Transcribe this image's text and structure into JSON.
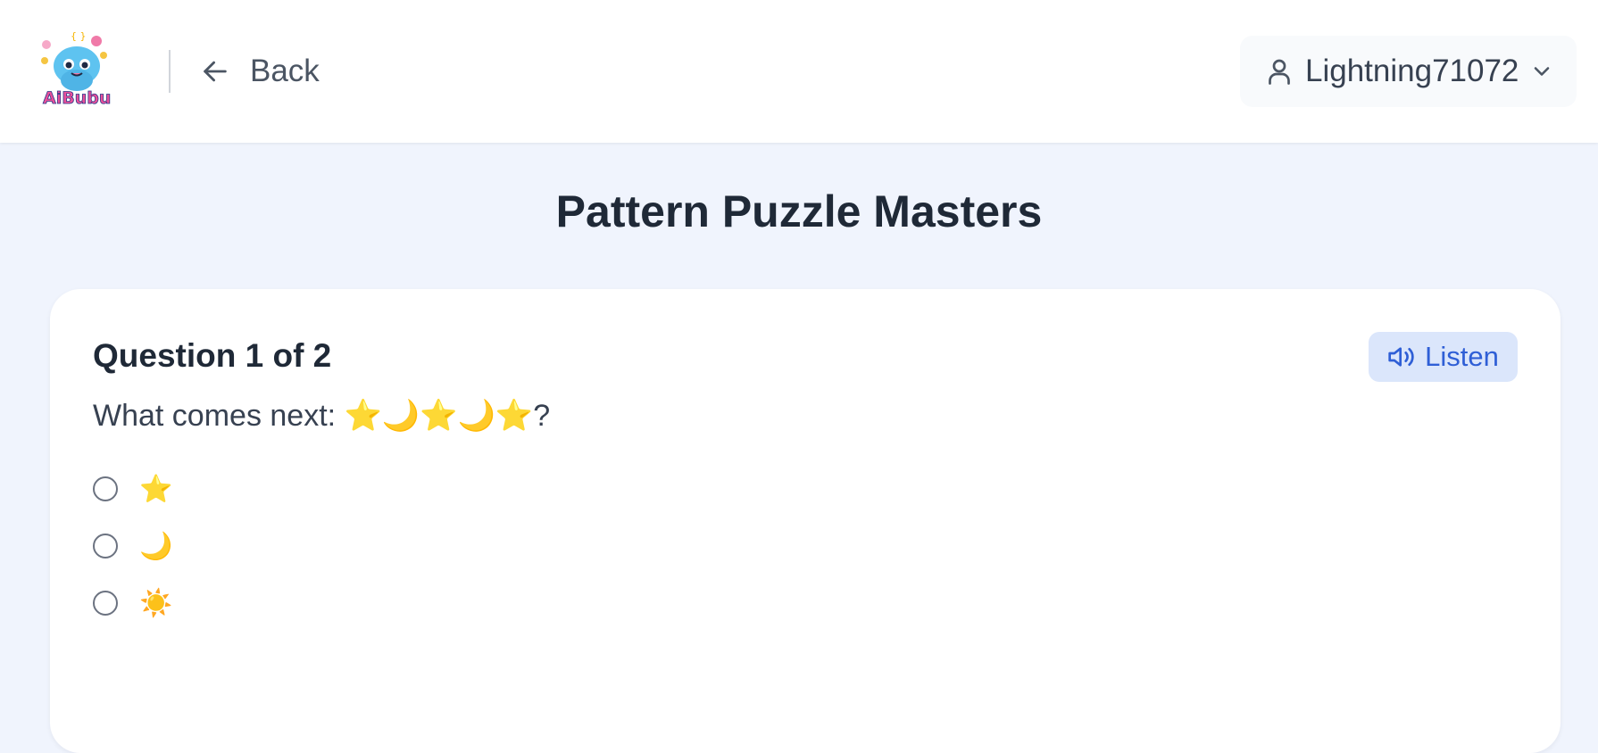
{
  "header": {
    "logo_text": "AiBubu",
    "back_label": "Back",
    "username": "Lightning71072"
  },
  "page": {
    "title": "Pattern Puzzle Masters"
  },
  "quiz": {
    "counter": "Question 1 of 2",
    "listen_label": "Listen",
    "question": "What comes next: ⭐🌙⭐🌙⭐?",
    "options": [
      {
        "label": "⭐",
        "selected": false
      },
      {
        "label": "🌙",
        "selected": false
      },
      {
        "label": "☀️",
        "selected": false
      }
    ]
  },
  "colors": {
    "background": "#f0f4fd",
    "accent": "#2f5fd6",
    "accent_bg": "#dbe6fb"
  }
}
